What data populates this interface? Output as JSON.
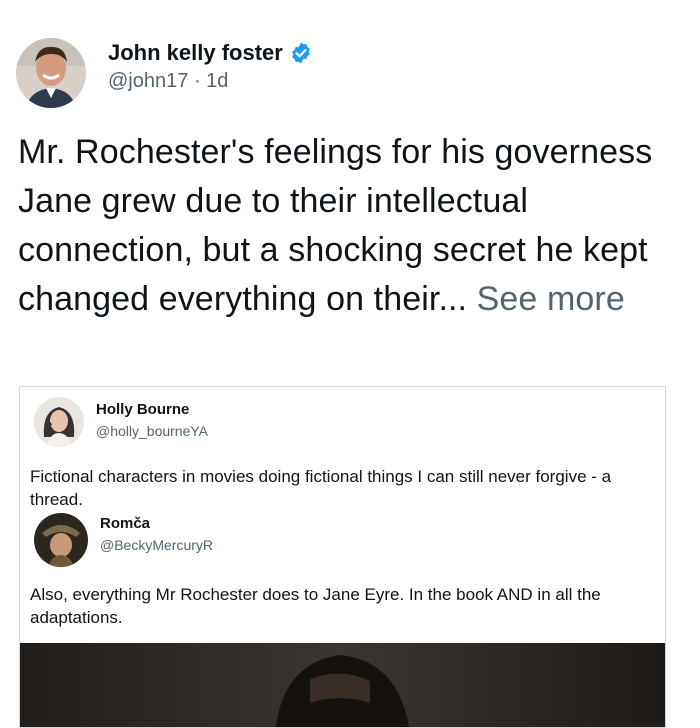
{
  "author": {
    "name": "John kelly foster",
    "handle": "@john17",
    "separator": "·",
    "time": "1d"
  },
  "post": {
    "text": "Mr. Rochester's feelings for his governess Jane grew due to their intellectual connection, but a shocking secret he kept changed everything on their...",
    "see_more": "See more"
  },
  "embed": {
    "tweet1": {
      "name": "Holly Bourne",
      "handle": "@holly_bourneYA",
      "text": "Fictional characters in movies doing fictional things I can still never forgive - a thread."
    },
    "tweet2": {
      "name": "Romča",
      "handle": "@BeckyMercuryR",
      "text": "Also, everything Mr Rochester does to Jane Eyre. In the book AND in all the adaptations."
    }
  },
  "colors": {
    "verified_badge": "#1d9bf0",
    "secondary_text": "#536471",
    "primary_text": "#0f1419",
    "border": "#cfd9de"
  },
  "icons": [
    "verified-badge-icon"
  ]
}
